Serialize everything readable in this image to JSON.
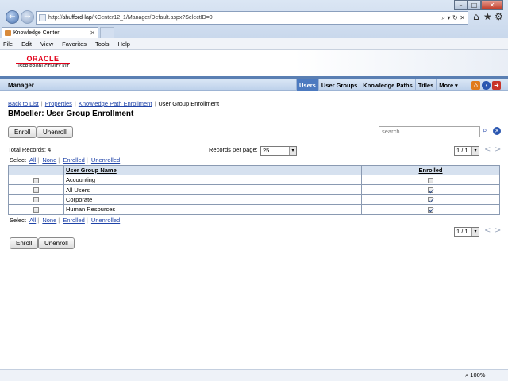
{
  "browser": {
    "url_prefix": "http://",
    "url_host": "ahufford-lap",
    "url_path": "/KCenter12_1/Manager/Default.aspx?SelectID=0",
    "addr_tools": "⌕ ▾ ↻ ✕",
    "tab_title": "Knowledge Center",
    "tab_close": "✕",
    "menu": [
      "File",
      "Edit",
      "View",
      "Favorites",
      "Tools",
      "Help"
    ],
    "back": "←",
    "forward": "→",
    "home": "⌂",
    "favorites": "★",
    "settings": "⚙",
    "minimize": "–",
    "maximize": "□",
    "close": "✕",
    "zoom": "⌕ 100%"
  },
  "brand": {
    "oracle": "ORACLE",
    "product": "USER PRODUCTIVITY KIT"
  },
  "header": {
    "title": "Manager",
    "nav": [
      "Users",
      "User Groups",
      "Knowledge Paths",
      "Titles",
      "More"
    ],
    "active": "Users",
    "icons": [
      "home-icon",
      "help-icon",
      "exit-icon"
    ]
  },
  "breadcrumb": {
    "links": [
      "Back to List",
      "Properties",
      "Knowledge Path Enrollment"
    ],
    "current": "User Group Enrollment",
    "sep": "|"
  },
  "page": {
    "title": "BMoeller: User Group Enrollment",
    "enroll": "Enroll",
    "unenroll": "Unenroll",
    "search_placeholder": "search",
    "total_records": "Total Records: 4",
    "records_per_page_label": "Records per page:",
    "records_per_page": "25",
    "page_indicator": "1 / 1",
    "dropdown_arrow": "▾",
    "prev": "<",
    "next": ">",
    "search_glyph": "⌕",
    "clear_glyph": "✕"
  },
  "select_filter": {
    "label": "Select",
    "options": [
      "All",
      "None",
      "Enrolled",
      "Unenrolled"
    ],
    "sep": "|"
  },
  "table": {
    "columns": [
      "User Group Name",
      "Enrolled"
    ],
    "rows": [
      {
        "name": "Accounting",
        "enrolled": false
      },
      {
        "name": "All Users",
        "enrolled": true
      },
      {
        "name": "Corporate",
        "enrolled": true
      },
      {
        "name": "Human Resources",
        "enrolled": true
      }
    ]
  },
  "colors": {
    "accent": "#4c7ac0",
    "oracle_red": "#e2001a",
    "link": "#1f43a8"
  }
}
